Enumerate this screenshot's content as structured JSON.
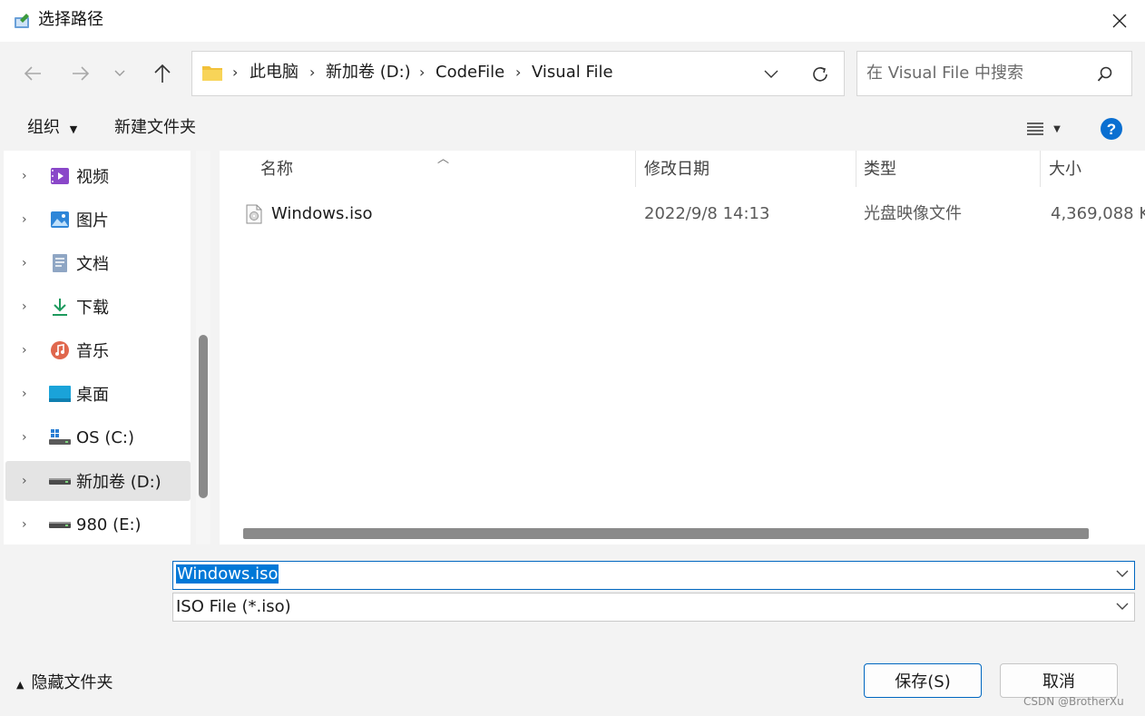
{
  "window": {
    "title": "选择路径"
  },
  "breadcrumb": [
    "此电脑",
    "新加卷 (D:)",
    "CodeFile",
    "Visual File"
  ],
  "search": {
    "placeholder": "在 Visual File 中搜索"
  },
  "toolbar": {
    "organize": "组织",
    "new_folder": "新建文件夹"
  },
  "nav": {
    "items": [
      {
        "label": "视频",
        "icon": "video-icon"
      },
      {
        "label": "图片",
        "icon": "pictures-icon"
      },
      {
        "label": "文档",
        "icon": "documents-icon"
      },
      {
        "label": "下载",
        "icon": "download-icon"
      },
      {
        "label": "音乐",
        "icon": "music-icon"
      },
      {
        "label": "桌面",
        "icon": "desktop-icon"
      },
      {
        "label": "OS (C:)",
        "icon": "windows-drive-icon"
      },
      {
        "label": "新加卷 (D:)",
        "icon": "drive-icon",
        "selected": true
      },
      {
        "label": "980 (E:)",
        "icon": "drive-icon"
      }
    ]
  },
  "columns": {
    "name": "名称",
    "date": "修改日期",
    "type": "类型",
    "size": "大小"
  },
  "files": [
    {
      "name": "Windows.iso",
      "date": "2022/9/8 14:13",
      "type": "光盘映像文件",
      "size": "4,369,088 K"
    }
  ],
  "filename": {
    "value": "Windows.iso"
  },
  "filetype": {
    "value": "ISO File (*.iso)"
  },
  "footer": {
    "hide_folders": "隐藏文件夹",
    "save": "保存(S)",
    "cancel": "取消"
  },
  "watermark": "CSDN @BrotherXu",
  "colors": {
    "accent": "#0067c0",
    "selection": "#0078d7",
    "help": "#0a6fd1"
  }
}
